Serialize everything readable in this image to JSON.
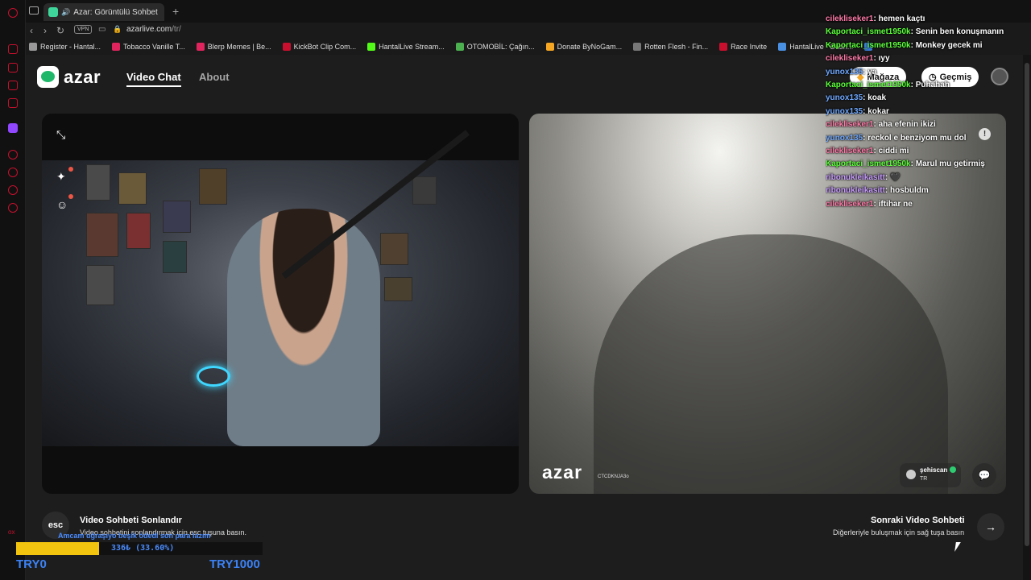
{
  "browser": {
    "tab_title": "Azar: Görüntülü Sohbet",
    "url_host": "azarlive.com",
    "url_path": "/tr/",
    "vpn_label": "VPN",
    "bookmarks": [
      {
        "label": "Register - Hantal...",
        "color": "#999999"
      },
      {
        "label": "Tobacco Vanille T...",
        "color": "#e0245e"
      },
      {
        "label": "Blerp Memes | Be...",
        "color": "#e0245e"
      },
      {
        "label": "KickBot Clip Com...",
        "color": "#c8102e"
      },
      {
        "label": "HantalLive Stream...",
        "color": "#53fc18"
      },
      {
        "label": "OTOMOBİL: Çağın...",
        "color": "#4caf50"
      },
      {
        "label": "Donate ByNoGam...",
        "color": "#f5a623"
      },
      {
        "label": "Rotten Flesh - Fin...",
        "color": "#777777"
      },
      {
        "label": "Race Invite",
        "color": "#c8102e"
      },
      {
        "label": "HantalLive - Dash...",
        "color": "#4a90e2"
      },
      {
        "label": "",
        "color": "#3a7bd5"
      }
    ]
  },
  "header": {
    "logo_text": "azar",
    "nav_video_chat": "Video Chat",
    "nav_about": "About",
    "shop_label": "Mağaza",
    "history_label": "Geçmiş"
  },
  "right_video": {
    "watermark": "azar",
    "room_code": "CTCDKNJA3o",
    "username": "şehiscan",
    "country": "TR"
  },
  "controls": {
    "esc_key": "esc",
    "end_title": "Video Sohbeti Sonlandır",
    "end_subtitle": "Video sohbetini sonlandırmak için esc tuşuna basın.",
    "next_title": "Sonraki Video Sohbeti",
    "next_subtitle": "Diğerleriyle buluşmak için sağ tuşa basın"
  },
  "chat": [
    {
      "user": "cilekliseker1",
      "color": "#ff7aa8",
      "msg": "hemen kaçtı"
    },
    {
      "user": "Kaportaci_ismet1950k",
      "color": "#5cff3a",
      "msg": "Senin ben konuşmanın"
    },
    {
      "user": "Kaportaci_ismet1950k",
      "color": "#5cff3a",
      "msg": "Monkey gecek mi"
    },
    {
      "user": "cilekliseker1",
      "color": "#ff7aa8",
      "msg": "ıyy"
    },
    {
      "user": "yunox135",
      "color": "#6fa8ff",
      "msg": "ya"
    },
    {
      "user": "Kaportaci_ismet1950k",
      "color": "#5cff3a",
      "msg": "Puhahah"
    },
    {
      "user": "yunox135",
      "color": "#6fa8ff",
      "msg": "koak"
    },
    {
      "user": "yunox135",
      "color": "#6fa8ff",
      "msg": "kokar"
    },
    {
      "user": "cilekliseker1",
      "color": "#ff7aa8",
      "msg": "aha efenin ikizi"
    },
    {
      "user": "yunox135",
      "color": "#6fa8ff",
      "msg": "reckol e benziyom mu dol"
    },
    {
      "user": "cilekliseker1",
      "color": "#ff7aa8",
      "msg": "ciddi mi"
    },
    {
      "user": "Kaportaci_ismet1950k",
      "color": "#5cff3a",
      "msg": "Marul mu getirmiş"
    },
    {
      "user": "ribonukleikasitt",
      "color": "#c79bff",
      "msg": "🖤"
    },
    {
      "user": "ribonukleikasitt",
      "color": "#c79bff",
      "msg": "hosbuldm"
    },
    {
      "user": "cilekliseker1",
      "color": "#ff7aa8",
      "msg": "iftihar ne"
    }
  ],
  "stream_goal": {
    "donation_text": "Amcam uğraşıyo beşik ödedi son para lazım",
    "progress_label": "336₺ (33.60%)",
    "progress_fraction": 0.336,
    "min_label": "TRY0",
    "max_label": "TRY1000"
  },
  "colors": {
    "azar_green": "#1fb86a",
    "opera_red": "#c8102e",
    "goal_yellow": "#f2c40f",
    "goal_blue": "#3b82f6"
  }
}
